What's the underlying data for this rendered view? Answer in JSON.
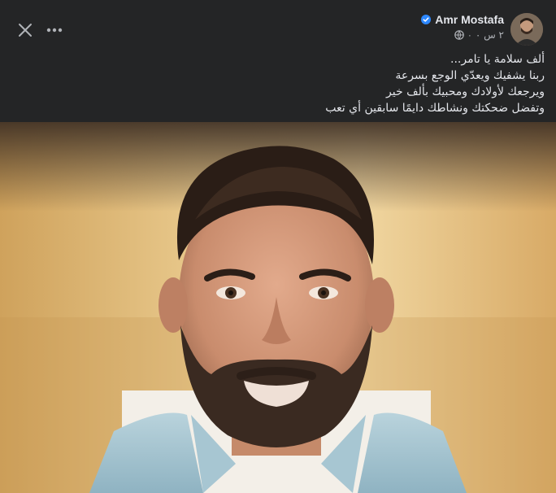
{
  "post": {
    "author": {
      "name": "Amr Mostafa",
      "verified": true
    },
    "meta": {
      "time": "٢ س ٠",
      "audience_icon": "globe-icon"
    },
    "text_lines": [
      "ألف سلامة يا تامر...",
      "ربنا يشفيك ويعدّي الوجع بسرعة",
      "ويرجعك لأولادك ومحبيك بألف خير",
      "وتفضل ضحكتك ونشاطك دايمًا سابقين أي تعب"
    ],
    "image": {
      "subject": "portrait of a smiling bearded man with a light blue scarf"
    }
  },
  "controls": {
    "close_icon": "close-icon",
    "more_icon": "more-options-icon"
  },
  "colors": {
    "background": "#242526",
    "text": "#e4e6eb",
    "secondary": "#b0b3b8",
    "verified": "#2d88ff"
  }
}
